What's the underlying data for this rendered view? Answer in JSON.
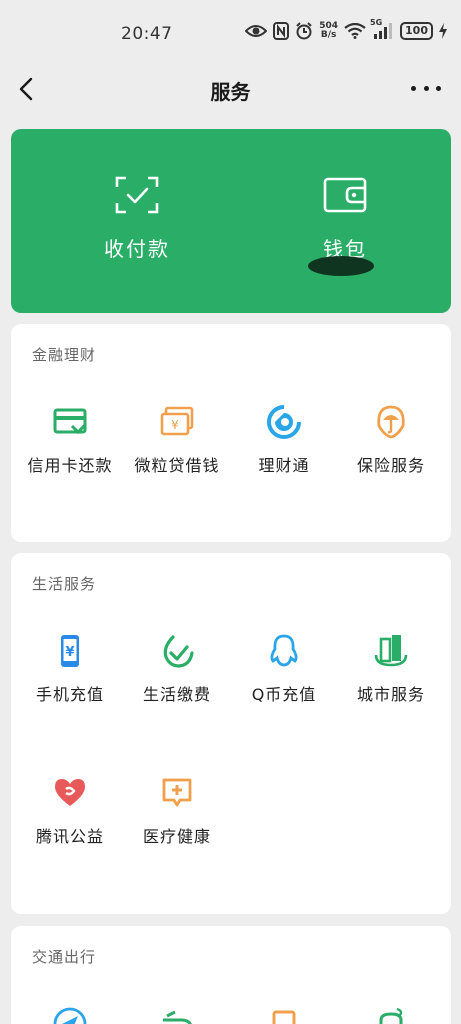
{
  "status_bar": {
    "time": "20:47",
    "net_speed_top": "504",
    "net_speed_bottom": "B/s",
    "signal_label": "5G",
    "battery": "100"
  },
  "nav": {
    "title": "服务",
    "back_icon": "chevron-left-icon",
    "more_icon": "more-dots-icon"
  },
  "top_card": {
    "color": "#2aae67",
    "pay_label": "收付款",
    "wallet_label": "钱包"
  },
  "sections": {
    "finance": {
      "title": "金融理财",
      "items": [
        {
          "label": "信用卡还款",
          "icon": "credit-card-icon",
          "color": "#2aae67"
        },
        {
          "label": "微粒贷借钱",
          "icon": "cash-icon",
          "color": "#f0a04b"
        },
        {
          "label": "理财通",
          "icon": "wealth-icon",
          "color": "#2aa6e8"
        },
        {
          "label": "保险服务",
          "icon": "umbrella-shield-icon",
          "color": "#f0a04b"
        }
      ]
    },
    "life": {
      "title": "生活服务",
      "items": [
        {
          "label": "手机充值",
          "icon": "phone-recharge-icon",
          "color": "#2a8ae8"
        },
        {
          "label": "生活缴费",
          "icon": "check-leaf-icon",
          "color": "#2aae67"
        },
        {
          "label": "Q币充值",
          "icon": "qq-penguin-icon",
          "color": "#2aa6e8"
        },
        {
          "label": "城市服务",
          "icon": "city-buildings-icon",
          "color": "#2aae67"
        },
        {
          "label": "腾讯公益",
          "icon": "heart-icon",
          "color": "#e85a5a"
        },
        {
          "label": "医疗健康",
          "icon": "medical-plus-icon",
          "color": "#f0a04b"
        }
      ]
    },
    "transport": {
      "title": "交通出行"
    }
  }
}
